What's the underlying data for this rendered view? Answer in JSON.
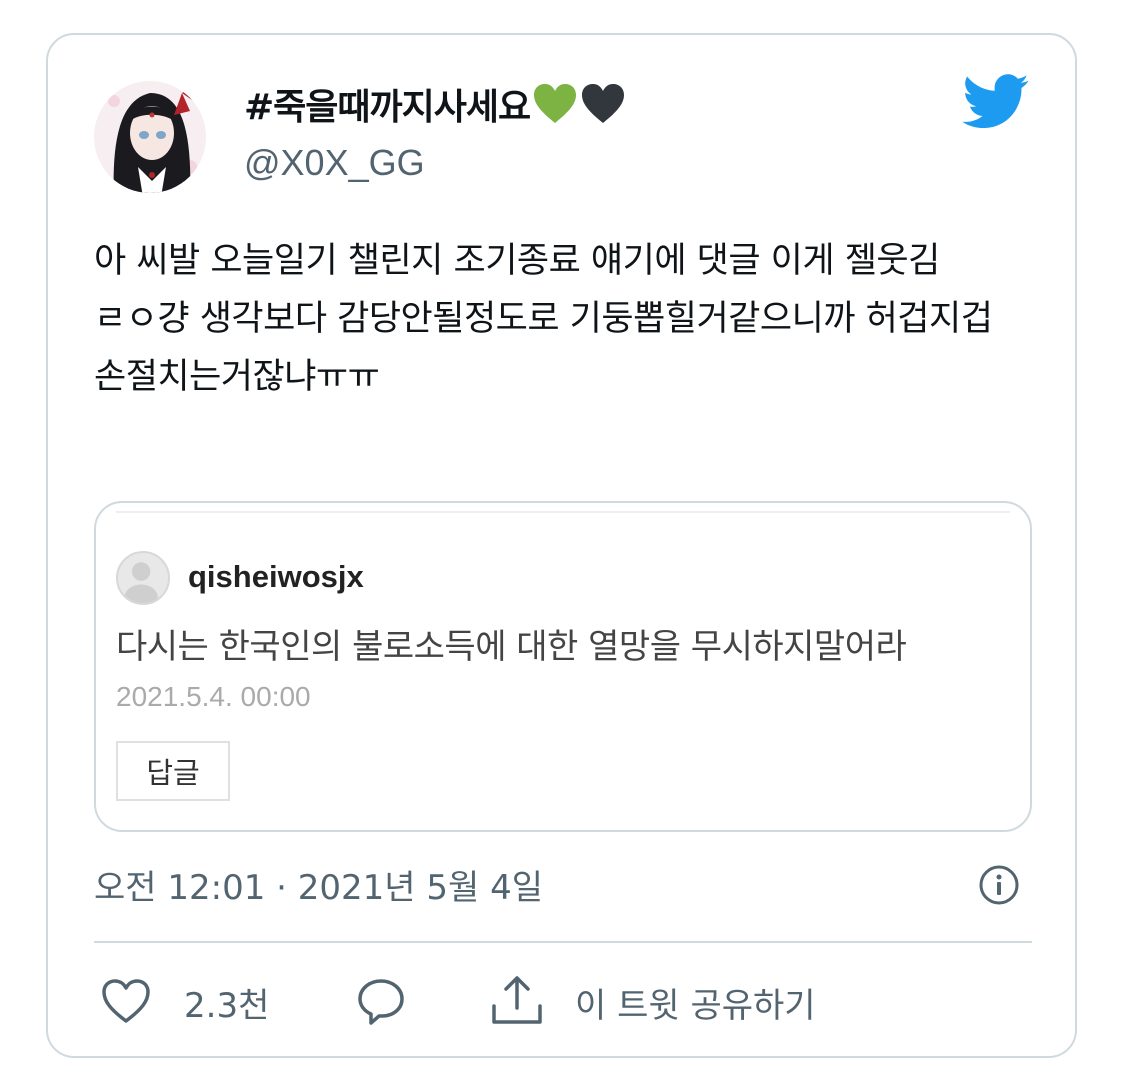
{
  "tweet": {
    "display_name": "#죽을때까지사세요",
    "name_emojis": [
      "green-heart-icon",
      "black-heart-icon"
    ],
    "handle": "@X0X_GG",
    "text": "아 씨발 오늘일기 챌린지 조기종료 얘기에 댓글 이게 젤웃김\nㄹㅇ걍 생각보다 감당안될정도로 기둥뽑힐거같으니까 허겁지겁 손절치는거잖냐ㅠㅠ",
    "timestamp": "오전 12:01 · 2021년 5월 4일",
    "likes": "2.3천",
    "share_label": "이 트윗 공유하기"
  },
  "embedded_comment": {
    "username": "qisheiwosjx",
    "text": "다시는 한국인의 불로소득에 대한 열망을 무시하지말어라",
    "date": "2021.5.4. 00:00",
    "reply_button": "답글"
  },
  "colors": {
    "twitter_blue": "#1d9bf0",
    "secondary_text": "#536471",
    "border": "#cfd9de",
    "green_heart": "#7cb342",
    "black_heart": "#31373d"
  }
}
